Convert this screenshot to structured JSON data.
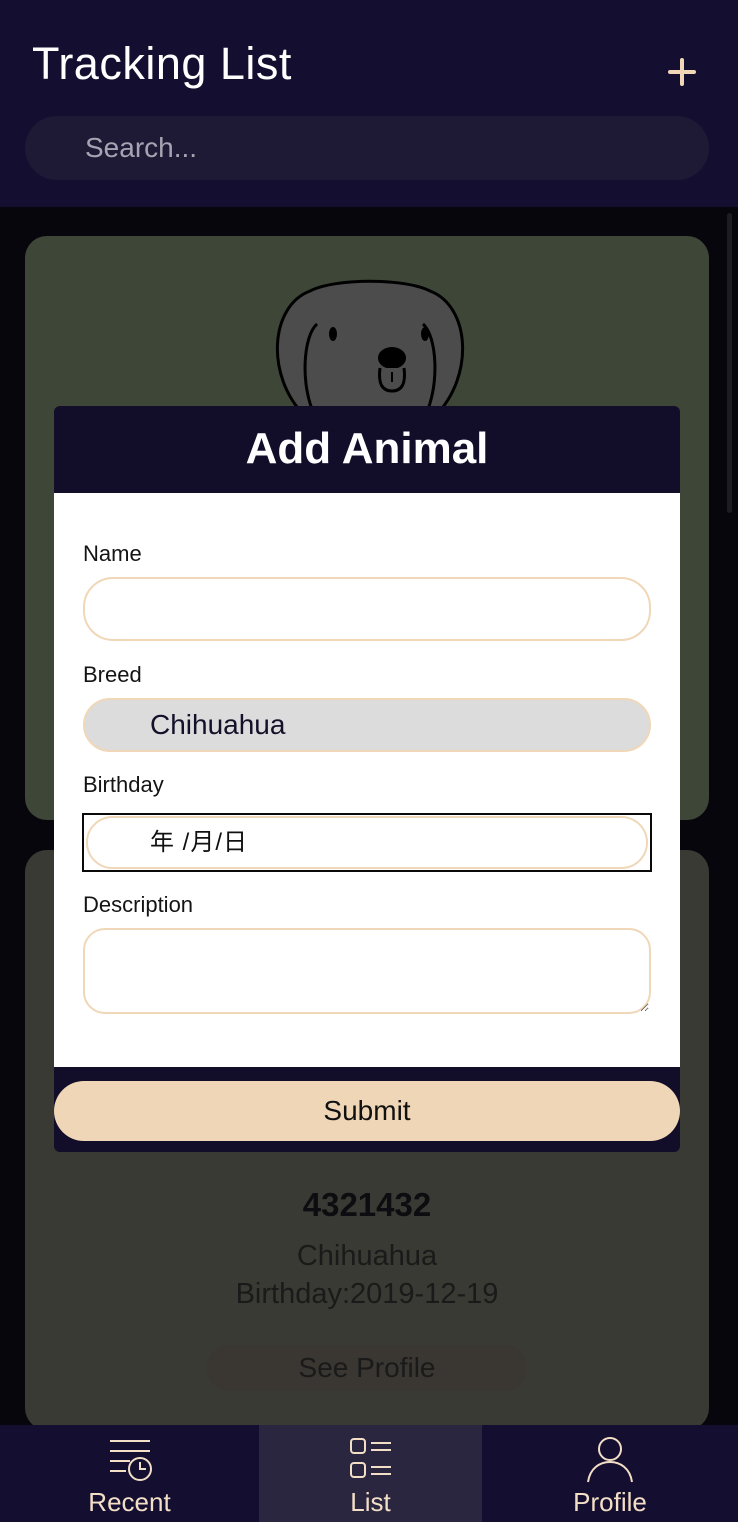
{
  "header": {
    "title": "Tracking List",
    "add_icon": "plus-icon",
    "search_placeholder": "Search..."
  },
  "cards": [
    {
      "image": "dog-face-illustration"
    },
    {
      "name": "4321432",
      "breed": "Chihuahua",
      "birthday": "Birthday:2019-12-19",
      "button_label": "See Profile"
    }
  ],
  "modal": {
    "title": "Add Animal",
    "fields": {
      "name_label": "Name",
      "name_value": "",
      "breed_label": "Breed",
      "breed_value": "Chihuahua",
      "birthday_label": "Birthday",
      "birthday_placeholder": "年 /月/日",
      "description_label": "Description",
      "description_value": ""
    },
    "submit_label": "Submit"
  },
  "bottom_nav": [
    {
      "label": "Recent",
      "icon": "recent-list-clock-icon",
      "active": false
    },
    {
      "label": "List",
      "icon": "list-icon",
      "active": true
    },
    {
      "label": "Profile",
      "icon": "person-icon",
      "active": false
    }
  ],
  "colors": {
    "header_bg": "#140f30",
    "accent": "#efd6b7",
    "card1_bg": "#3e4638",
    "card2_bg": "#393a33",
    "active_nav_bg": "#2a263f"
  }
}
